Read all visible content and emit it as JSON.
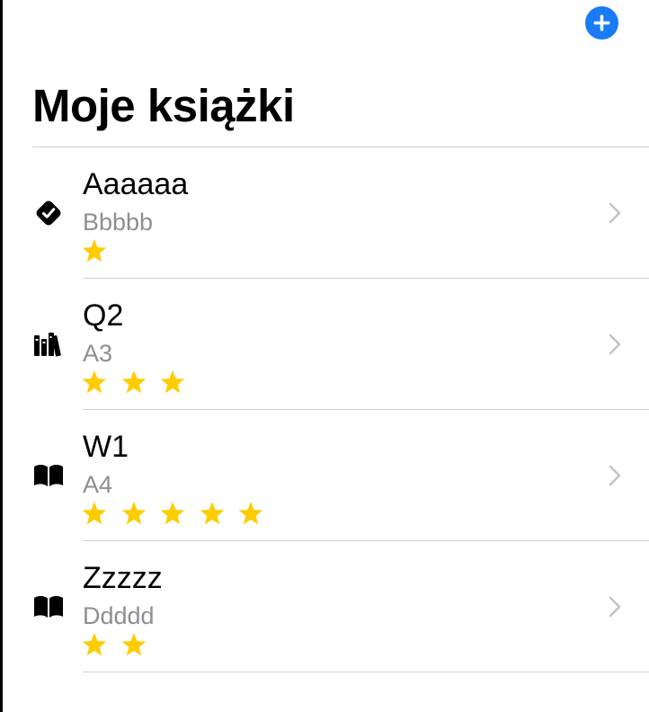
{
  "header": {
    "title": "Moje książki",
    "add_button_icon": "plus-circle-icon",
    "accent_color": "#1a7cf5"
  },
  "books": [
    {
      "title": "Aaaaaa",
      "author": "Bbbbb",
      "rating": 1,
      "status_icon": "checkmark-seal-icon"
    },
    {
      "title": "Q2",
      "author": "A3",
      "rating": 3,
      "status_icon": "books-on-shelf-icon"
    },
    {
      "title": "W1",
      "author": "A4",
      "rating": 5,
      "status_icon": "open-book-icon"
    },
    {
      "title": "Zzzzz",
      "author": "Ddddd",
      "rating": 2,
      "status_icon": "open-book-icon"
    }
  ],
  "colors": {
    "star": "#ffcc00",
    "secondary_text": "#8e8e93",
    "chevron": "#c4c4c7",
    "divider": "#d1d1d6"
  }
}
